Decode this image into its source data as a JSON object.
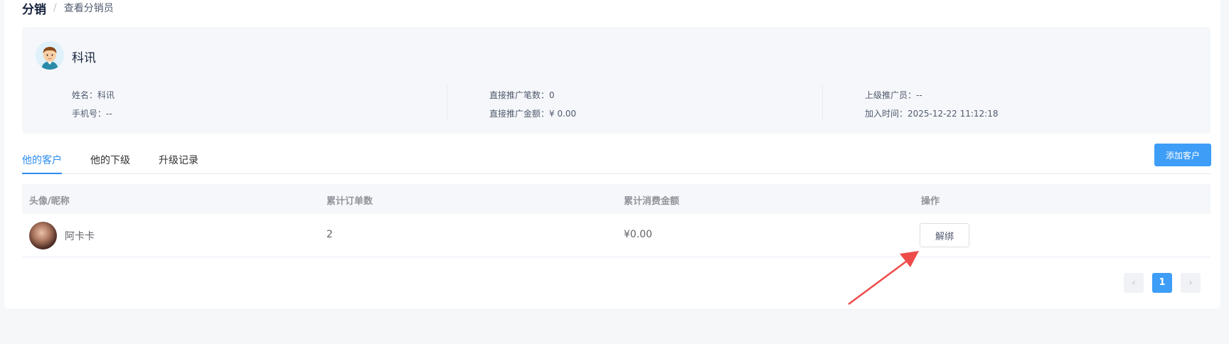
{
  "breadcrumb": {
    "root": "分销",
    "separator": "/",
    "current": "查看分销员"
  },
  "profile": {
    "name": "科讯",
    "fields": {
      "name_label": "姓名：",
      "name_value": "科讯",
      "phone_label": "手机号：",
      "phone_value": "--",
      "orders_label": "直接推广笔数：",
      "orders_value": "0",
      "amount_label": "直接推广金额：",
      "amount_value": "¥ 0.00",
      "parent_label": "上级推广员：",
      "parent_value": "--",
      "join_label": "加入时间：",
      "join_value": "2025-12-22 11:12:18"
    }
  },
  "tabs": [
    {
      "label": "他的客户",
      "active": true
    },
    {
      "label": "他的下级",
      "active": false
    },
    {
      "label": "升级记录",
      "active": false
    }
  ],
  "actions": {
    "add_customer": "添加客户"
  },
  "table": {
    "columns": [
      "头像/昵称",
      "累计订单数",
      "累计消费金额",
      "操作"
    ],
    "rows": [
      {
        "nickname": "阿卡卡",
        "orders": "2",
        "amount": "¥0.00",
        "action": "解绑"
      }
    ]
  },
  "pagination": {
    "prev_icon": "chevron-left-icon",
    "current": "1",
    "next_icon": "chevron-right-icon"
  },
  "colors": {
    "primary": "#3d9df7",
    "tab_active": "#2d8cf0",
    "annotation_arrow": "#ee4b4b"
  }
}
